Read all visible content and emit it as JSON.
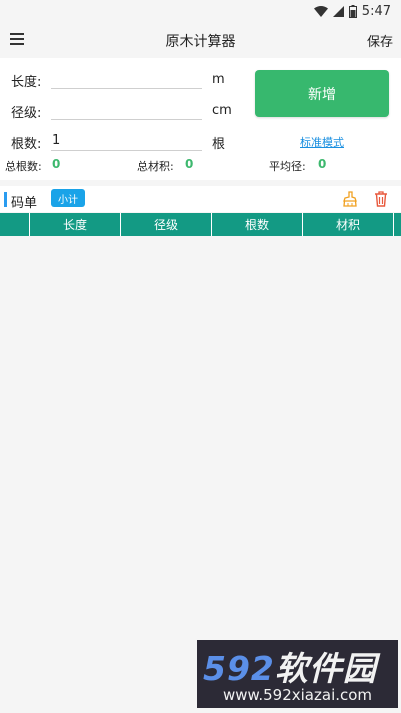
{
  "status": {
    "time": "5:47"
  },
  "app": {
    "title": "原木计算器",
    "save_label": "保存"
  },
  "form": {
    "length_label": "长度:",
    "length_value": "",
    "length_unit": "m",
    "diameter_label": "径级:",
    "diameter_value": "",
    "diameter_unit": "cm",
    "count_label": "根数:",
    "count_value": "1",
    "count_unit": "根",
    "add_label": "新增",
    "mode_link": "标准模式"
  },
  "summary": {
    "total_count_label": "总根数:",
    "total_count_value": "0",
    "total_volume_label": "总材积:",
    "total_volume_value": "0",
    "avg_diameter_label": "平均径:",
    "avg_diameter_value": "0"
  },
  "list": {
    "title": "码单",
    "subtotal_label": "小计",
    "columns": [
      "长度",
      "径级",
      "根数",
      "材积"
    ]
  },
  "watermark": {
    "number": "592",
    "name": "软件园",
    "url": "www.592xiazai.com"
  },
  "colors": {
    "primary_green": "#37b86e",
    "table_header": "#139a84",
    "accent_blue": "#2a9cf0",
    "value_green": "#3db86e",
    "delete_red": "#e8583c",
    "brush_yellow": "#f0a020"
  }
}
